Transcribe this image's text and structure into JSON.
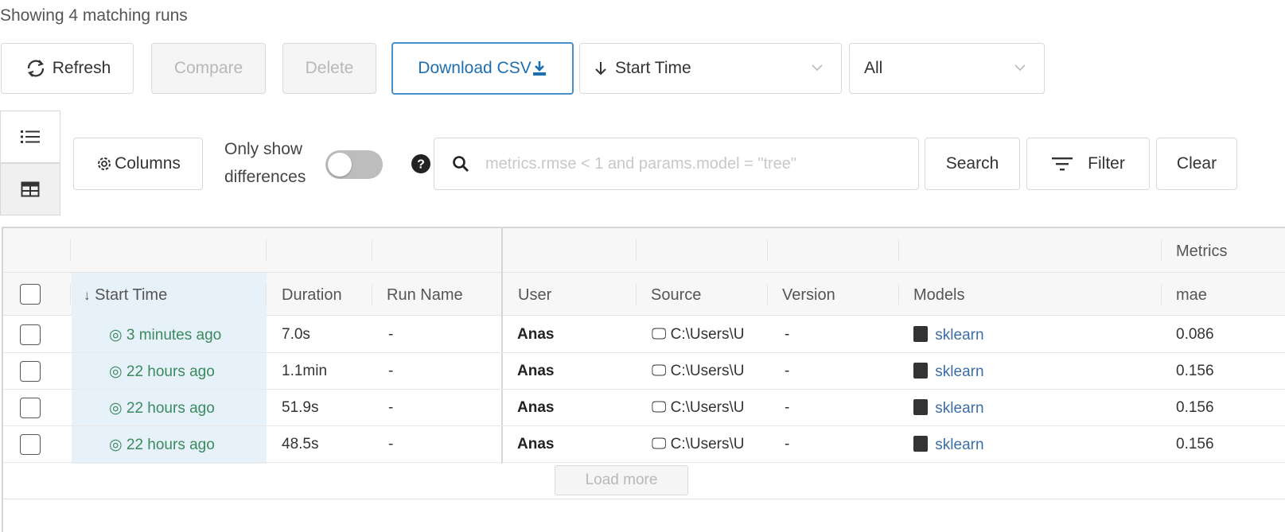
{
  "header": {
    "matching_text": "Showing 4 matching runs"
  },
  "toolbar": {
    "refresh_label": "Refresh",
    "compare_label": "Compare",
    "delete_label": "Delete",
    "download_label": "Download CSV",
    "sort_select": "Start Time",
    "filter_select": "All"
  },
  "controls": {
    "columns_label": "Columns",
    "only_show_line1": "Only show",
    "only_show_line2": "differences",
    "search_placeholder": "metrics.rmse < 1 and params.model = \"tree\"",
    "search_label": "Search",
    "filter_label": "Filter",
    "clear_label": "Clear"
  },
  "table": {
    "group_header": "Metrics",
    "columns": [
      "Start Time",
      "Duration",
      "Run Name",
      "User",
      "Source",
      "Version",
      "Models",
      "mae"
    ],
    "rows": [
      {
        "start_time": "3 minutes ago",
        "duration": "7.0s",
        "run_name": "-",
        "user": "Anas",
        "source": "C:\\Users\\U",
        "version": "-",
        "model": "sklearn",
        "mae": "0.086"
      },
      {
        "start_time": "22 hours ago",
        "duration": "1.1min",
        "run_name": "-",
        "user": "Anas",
        "source": "C:\\Users\\U",
        "version": "-",
        "model": "sklearn",
        "mae": "0.156"
      },
      {
        "start_time": "22 hours ago",
        "duration": "51.9s",
        "run_name": "-",
        "user": "Anas",
        "source": "C:\\Users\\U",
        "version": "-",
        "model": "sklearn",
        "mae": "0.156"
      },
      {
        "start_time": "22 hours ago",
        "duration": "48.5s",
        "run_name": "-",
        "user": "Anas",
        "source": "C:\\Users\\U",
        "version": "-",
        "model": "sklearn",
        "mae": "0.156"
      }
    ],
    "load_more_label": "Load more"
  },
  "colors": {
    "accent": "#1f6fb0",
    "success": "#3b8a5e",
    "sorted_bg": "#e6f1fa"
  }
}
